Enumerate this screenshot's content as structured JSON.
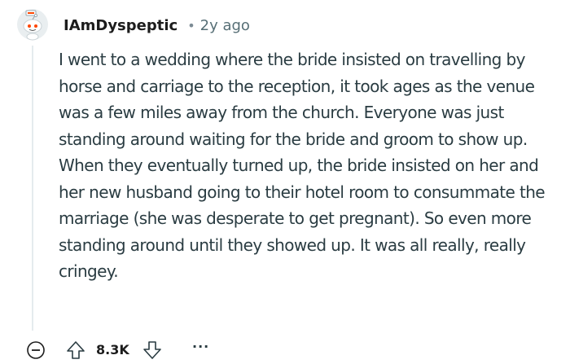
{
  "comment": {
    "username": "IAmDyspeptic",
    "separator": "•",
    "timestamp": "2y ago",
    "body": "I went to a wedding where the bride insisted on travelling by horse and carriage to the reception, it took ages as the venue was a few miles away from the church. Everyone was just standing around waiting for the bride and groom to show up. When they eventually turned up, the bride insisted on her and her new husband going to their hotel room to consummate the marriage (she was desperate to get pregnant). So even more standing around until they showed up. It was all really, really cringey.",
    "score": "8.3K",
    "more_label": "···"
  },
  "icons": {
    "avatar": "snoo-avatar-icon",
    "collapse": "collapse-minus-icon",
    "upvote": "upvote-arrow-icon",
    "downvote": "downvote-arrow-icon",
    "more": "more-options-icon"
  },
  "colors": {
    "text": "#1c1c1c",
    "body_text": "#2a3c42",
    "meta": "#576f76",
    "thread_line": "#e5ebee",
    "avatar_bg": "#e9eef0"
  }
}
